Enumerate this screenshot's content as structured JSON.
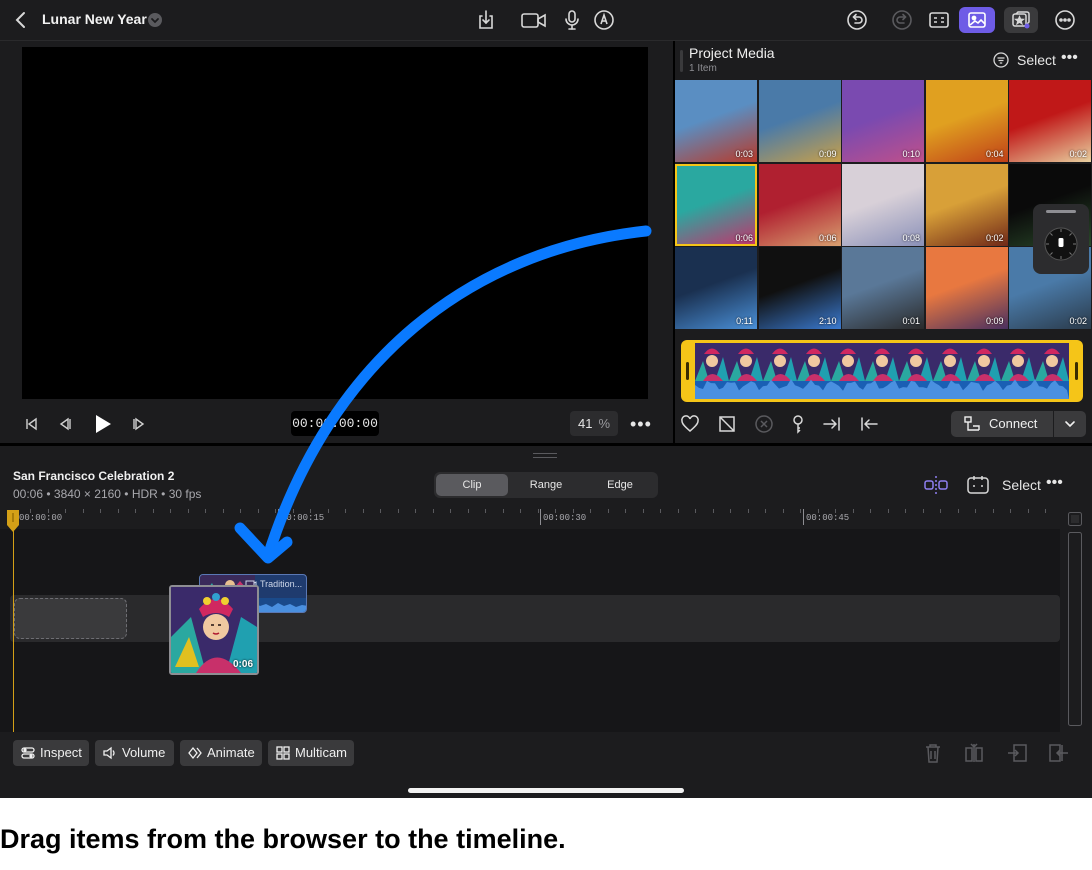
{
  "topbar": {
    "project_title": "Lunar New Year",
    "icons": [
      "back-chevron-icon",
      "export-icon",
      "camera-icon",
      "microphone-icon",
      "pen-icon",
      "undo-icon",
      "redo-icon",
      "inspector-icon",
      "photos-icon",
      "sticker-icon",
      "more-icon"
    ]
  },
  "viewer": {
    "timecode": "00:00:00:00",
    "zoom_value": "41",
    "zoom_unit": "%",
    "more": "•••"
  },
  "browser": {
    "title": "Project Media",
    "subtitle": "1 Item",
    "select_label": "Select",
    "more": "•••",
    "thumbnails": [
      {
        "duration": "0:03",
        "colors": [
          "#5a8ec2",
          "#b83a2a"
        ]
      },
      {
        "duration": "0:09",
        "colors": [
          "#4a7aa8",
          "#c8a04a"
        ]
      },
      {
        "duration": "0:10",
        "colors": [
          "#7a4ab0",
          "#c0508a"
        ]
      },
      {
        "duration": "0:04",
        "colors": [
          "#e0a020",
          "#c04018"
        ]
      },
      {
        "duration": "0:02",
        "colors": [
          "#c01818",
          "#e8d0a0"
        ]
      },
      {
        "duration": "0:06",
        "colors": [
          "#2aa8a0",
          "#c8306a"
        ],
        "selected": true
      },
      {
        "duration": "0:06",
        "colors": [
          "#b02030",
          "#d8a070"
        ]
      },
      {
        "duration": "0:08",
        "colors": [
          "#d8d0d8",
          "#8a90b8"
        ]
      },
      {
        "duration": "0:02",
        "colors": [
          "#d8a038",
          "#702818"
        ]
      },
      {
        "duration": "",
        "colors": [
          "#0a0a0a",
          "#2a4a2a"
        ]
      },
      {
        "duration": "0:11",
        "colors": [
          "#1a3050",
          "#4a90d8"
        ]
      },
      {
        "duration": "2:10",
        "colors": [
          "#101010",
          "#3a7ad0"
        ]
      },
      {
        "duration": "0:01",
        "colors": [
          "#5a7898",
          "#2a2a2a"
        ]
      },
      {
        "duration": "0:09",
        "colors": [
          "#e87840",
          "#4a3060"
        ]
      },
      {
        "duration": "0:02",
        "colors": [
          "#4a7aa8",
          "#2a3a4a"
        ]
      }
    ],
    "connect_label": "Connect"
  },
  "timeline": {
    "clip_name": "San Francisco Celebration 2",
    "clip_meta": "00:06 • 3840 × 2160 • HDR • 30 fps",
    "modes": [
      "Clip",
      "Range",
      "Edge"
    ],
    "active_mode": "Clip",
    "select_label": "Select",
    "more": "•••",
    "ruler": [
      "00:00:00",
      "00:00:15",
      "00:00:30",
      "00:00:45"
    ],
    "ghost_clip_label": "Tradition...",
    "drag_thumb_duration": "0:06"
  },
  "bottom_toolbar": {
    "buttons": [
      {
        "label": "Inspect",
        "icon": "inspect-icon"
      },
      {
        "label": "Volume",
        "icon": "speaker-icon"
      },
      {
        "label": "Animate",
        "icon": "keyframe-icon"
      },
      {
        "label": "Multicam",
        "icon": "grid-icon"
      }
    ],
    "icons": [
      "trash-icon",
      "split-icon",
      "detach-icon",
      "replace-icon"
    ]
  },
  "caption": "Drag items from the browser to the timeline.",
  "colors": {
    "accent_purple": "#6e5ce6",
    "playhead_yellow": "#d4a017",
    "selection_yellow": "#f5c518",
    "arrow_blue": "#0a7aff"
  }
}
